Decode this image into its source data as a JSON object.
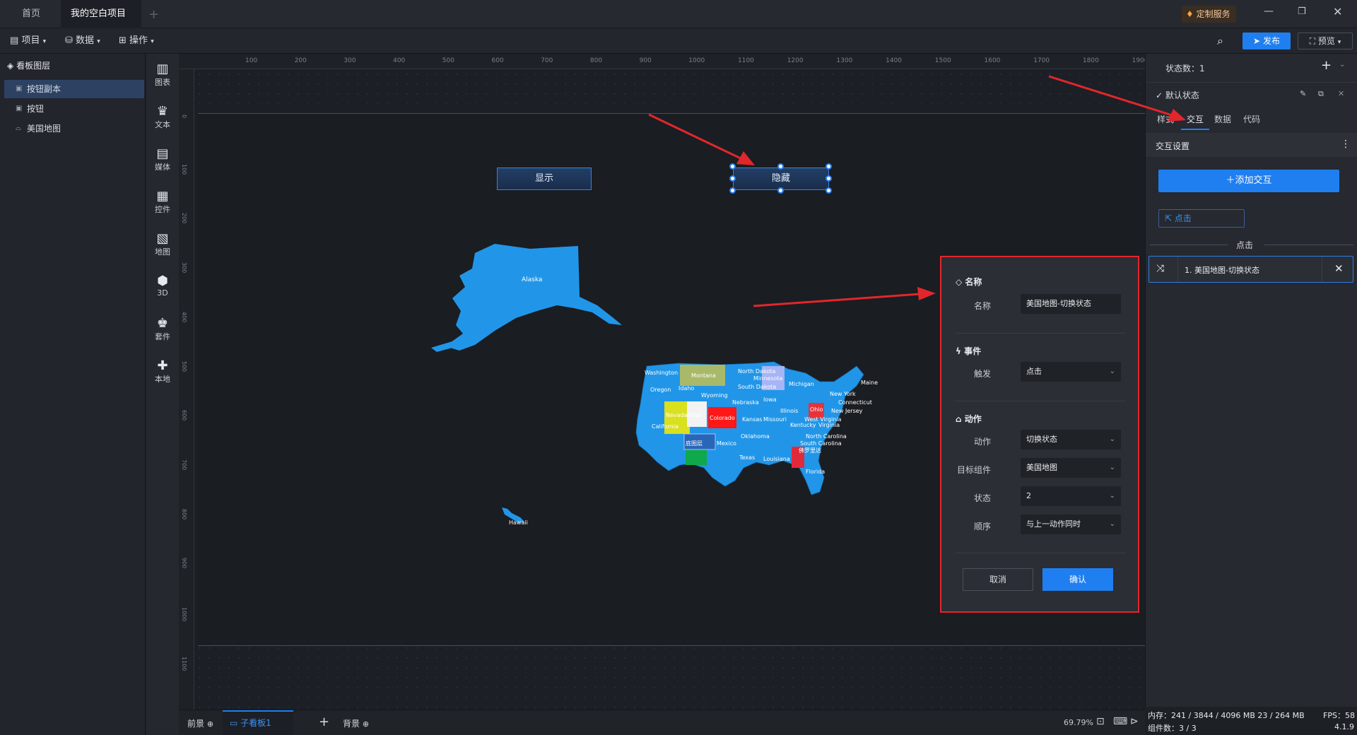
{
  "tabs": {
    "home": "首页",
    "project": "我的空白项目"
  },
  "service": "定制服务",
  "toolbar": {
    "project": "项目",
    "data": "数据",
    "operate": "操作",
    "publish": "发布",
    "preview": "预览"
  },
  "layers": {
    "title": "看板图层",
    "items": [
      "按钮副本",
      "按钮",
      "美国地图"
    ]
  },
  "sidebar_icons": [
    "图表",
    "文本",
    "媒体",
    "控件",
    "地图",
    "3D",
    "套件",
    "本地"
  ],
  "ruler_ticks": [
    "100",
    "200",
    "300",
    "400",
    "500",
    "600",
    "700",
    "800",
    "900",
    "1000",
    "1100",
    "1200",
    "1300",
    "1400",
    "1500",
    "1600",
    "1700",
    "1800",
    "1900"
  ],
  "ruler_ticks_v": [
    "0",
    "100",
    "200",
    "300",
    "400",
    "500",
    "600",
    "700",
    "800",
    "900",
    "1000",
    "1100"
  ],
  "canvas": {
    "show_button": "显示",
    "hide_button": "隐藏"
  },
  "map": {
    "states": [
      "Alaska",
      "Hawaii",
      "Washington",
      "Montana",
      "North Dakota",
      "Minnesota",
      "Oregon",
      "Idaho",
      "South Dakota",
      "Wyoming",
      "Michigan",
      "Maine",
      "Nebraska",
      "Iowa",
      "New York",
      "Connecticut",
      "Ohio",
      "New Jersey",
      "Nevada",
      "Utah",
      "Colorado",
      "Kansas",
      "Missouri",
      "Illinois",
      "West Virginia",
      "Kentucky",
      "Virginia",
      "California",
      "底图层",
      "Mexico",
      "Oklahoma",
      "North Carolina",
      "South Carolina",
      "Texas",
      "Louisiana",
      "佛罗里达",
      "Florida"
    ]
  },
  "bottom": {
    "front": "前景",
    "board": "子看板1",
    "back": "背景",
    "zoom": "69.79%"
  },
  "right": {
    "state_count": "状态数：1",
    "default_state": "默认状态",
    "tabs": [
      "样式",
      "交互",
      "数据",
      "代码"
    ],
    "interaction_settings": "交互设置",
    "add_interaction": "＋添加交互",
    "click_tag": "点击",
    "click_divider": "点击",
    "interaction_item": "1. 美国地图-切换状态"
  },
  "dialog": {
    "name_section": "名称",
    "name_label": "名称",
    "name_value": "美国地图-切换状态",
    "event_section": "事件",
    "trigger_label": "触发",
    "trigger_value": "点击",
    "action_section": "动作",
    "action_label": "动作",
    "action_value": "切换状态",
    "target_label": "目标组件",
    "target_value": "美国地图",
    "state_label": "状态",
    "state_value": "2",
    "order_label": "顺序",
    "order_value": "与上一动作同时",
    "cancel": "取消",
    "confirm": "确认"
  },
  "stats": {
    "memory": "内存：241 / 3844 / 4096 MB  23 / 264 MB",
    "fps": "FPS：58",
    "components": "组件数：3 / 3",
    "version": "4.1.9"
  },
  "colors": {
    "accent": "#1f7ff0",
    "highlight": "#e1272c",
    "map_blue": "#2196e8"
  }
}
